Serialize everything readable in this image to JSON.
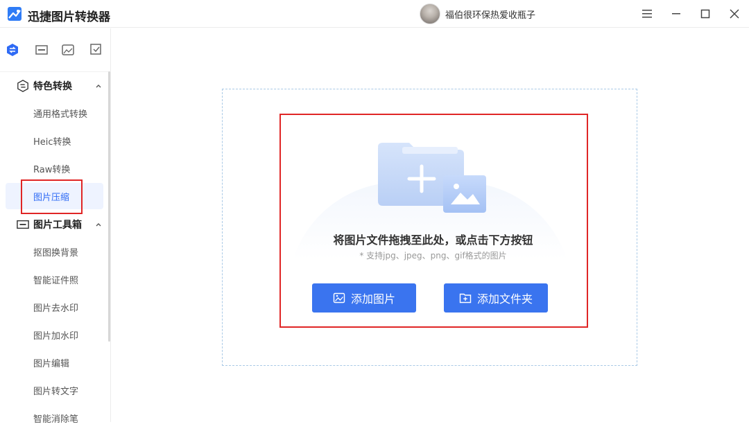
{
  "app": {
    "title": "迅捷图片转换器"
  },
  "user": {
    "name": "福伯很环保热爱收瓶子"
  },
  "window_controls": [
    "menu-icon",
    "minimize-icon",
    "maximize-icon",
    "close-icon"
  ],
  "sidebar": {
    "icon_tabs": [
      "convert-icon",
      "toolbox-icon",
      "image-icon",
      "check-icon"
    ],
    "groups": [
      {
        "label": "特色转换",
        "items": [
          "通用格式转换",
          "Heic转换",
          "Raw转换",
          "图片压缩"
        ]
      },
      {
        "label": "图片工具箱",
        "items": [
          "抠图换背景",
          "智能证件照",
          "图片去水印",
          "图片加水印",
          "图片编辑",
          "图片转文字",
          "智能消除笔"
        ]
      }
    ],
    "active_item": "图片压缩"
  },
  "main": {
    "drop_title": "将图片文件拖拽至此处，或点击下方按钮",
    "drop_hint": "* 支持jpg、jpeg、png、gif格式的图片",
    "add_image_label": "添加图片",
    "add_folder_label": "添加文件夹"
  },
  "colors": {
    "accent": "#3a74ef",
    "highlight": "#e02525",
    "active_bg": "#eef3ff"
  }
}
